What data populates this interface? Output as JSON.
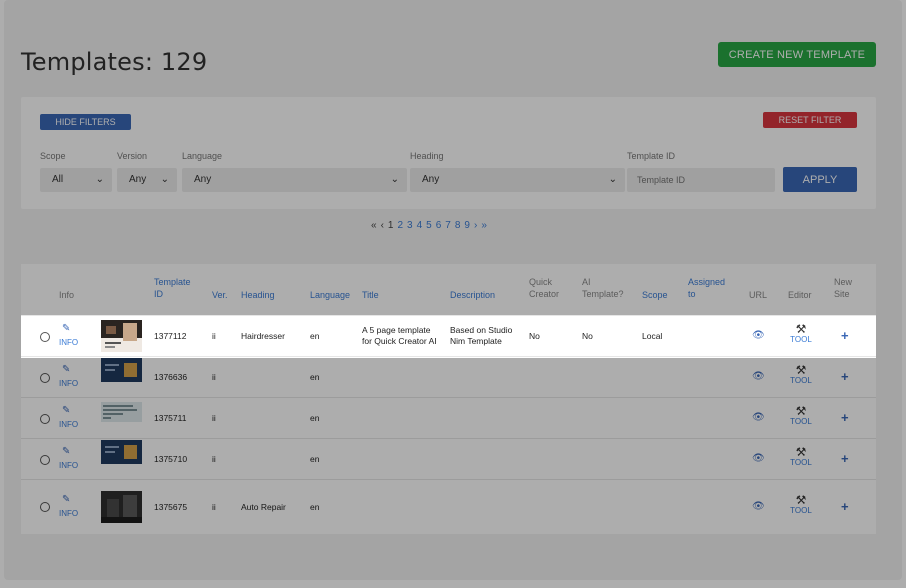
{
  "header": {
    "title": "Templates: 129",
    "create_button": "CREATE NEW TEMPLATE"
  },
  "filters": {
    "hide_button": "HIDE FILTERS",
    "reset_button": "RESET FILTER",
    "scope": {
      "label": "Scope",
      "value": "All"
    },
    "version": {
      "label": "Version",
      "value": "Any"
    },
    "language": {
      "label": "Language",
      "value": "Any"
    },
    "heading": {
      "label": "Heading",
      "value": "Any"
    },
    "template_id": {
      "label": "Template ID",
      "placeholder": "Template ID"
    },
    "apply_button": "APPLY"
  },
  "pagination": {
    "first": "«",
    "prev": "‹",
    "current": "1",
    "pages": [
      "2",
      "3",
      "4",
      "5",
      "6",
      "7",
      "8",
      "9"
    ],
    "next": "›",
    "last": "»"
  },
  "table": {
    "columns": {
      "info": "Info",
      "template_id_1": "Template",
      "template_id_2": "ID",
      "ver": "Ver.",
      "heading": "Heading",
      "language": "Language",
      "title": "Title",
      "description": "Description",
      "quick_creator_1": "Quick",
      "quick_creator_2": "Creator",
      "ai_template_1": "AI",
      "ai_template_2": "Template?",
      "scope": "Scope",
      "assigned_1": "Assigned",
      "assigned_2": "to",
      "url": "URL",
      "editor": "Editor",
      "new_site_1": "New",
      "new_site_2": "Site"
    },
    "info_label": "INFO",
    "tool_label": "TOOL",
    "rows": [
      {
        "id": "1377112",
        "ver": "ii",
        "heading": "Hairdresser",
        "language": "en",
        "title_1": "A 5 page template",
        "title_2": "for Quick Creator AI",
        "desc_1": "Based on Studio",
        "desc_2": "Nim Template",
        "quick": "No",
        "ai": "No",
        "scope": "Local",
        "thumb": "salon"
      },
      {
        "id": "1376636",
        "ver": "ii",
        "heading": "",
        "language": "en",
        "thumb": "navy"
      },
      {
        "id": "1375711",
        "ver": "ii",
        "heading": "",
        "language": "en",
        "thumb": "text"
      },
      {
        "id": "1375710",
        "ver": "ii",
        "heading": "",
        "language": "en",
        "thumb": "navy"
      },
      {
        "id": "1375675",
        "ver": "ii",
        "heading": "Auto Repair",
        "language": "en",
        "thumb": "garage"
      }
    ]
  },
  "colors": {
    "primary": "#3a67b5",
    "success": "#28a745",
    "danger": "#d9363e",
    "link": "#3a7bd5"
  }
}
